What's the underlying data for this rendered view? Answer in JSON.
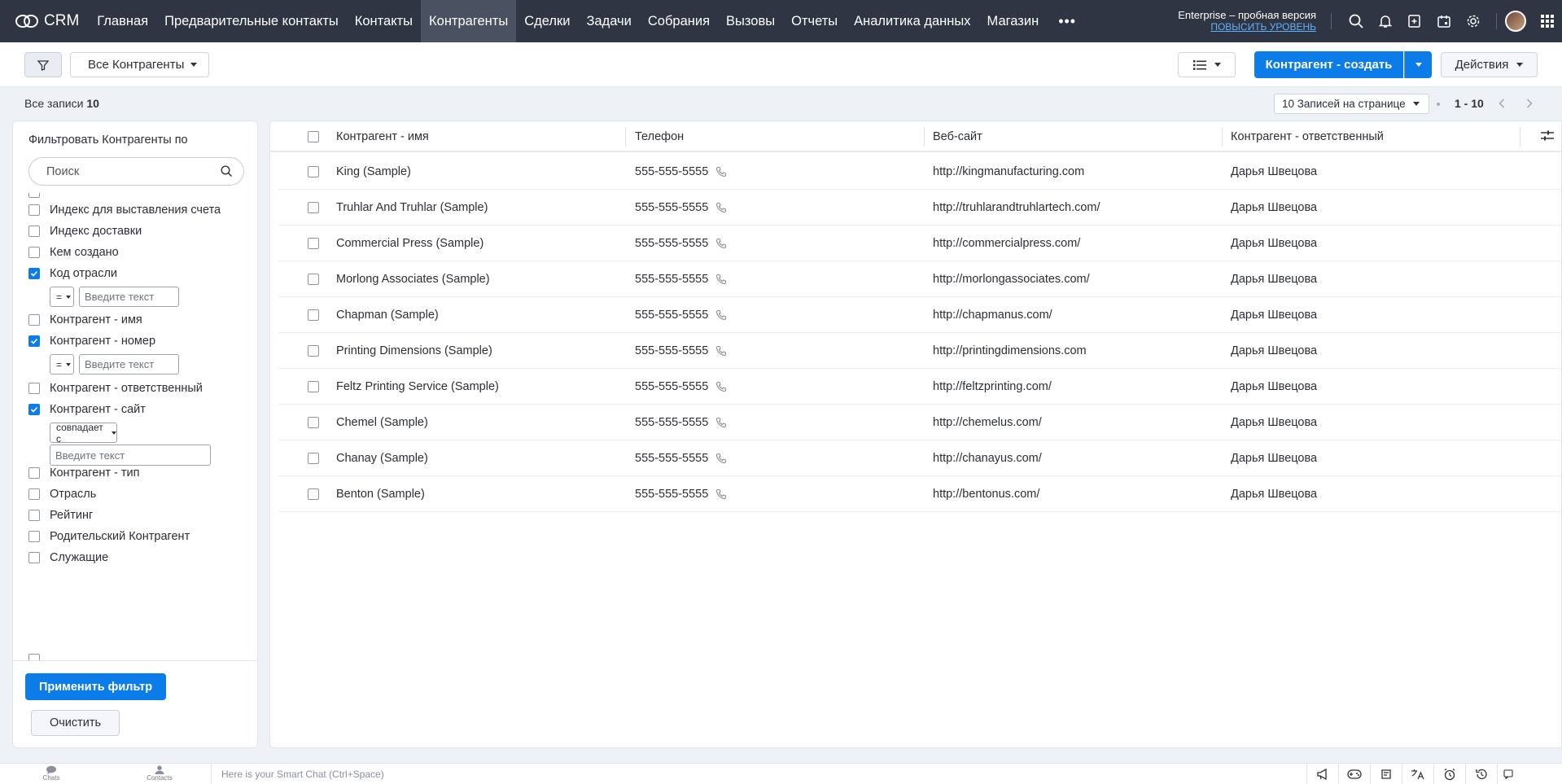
{
  "app": {
    "logo_text": "CRM"
  },
  "nav": {
    "items": [
      {
        "label": "Главная",
        "active": false
      },
      {
        "label": "Предварительные контакты",
        "active": false
      },
      {
        "label": "Контакты",
        "active": false
      },
      {
        "label": "Контрагенты",
        "active": true
      },
      {
        "label": "Сделки",
        "active": false
      },
      {
        "label": "Задачи",
        "active": false
      },
      {
        "label": "Собрания",
        "active": false
      },
      {
        "label": "Вызовы",
        "active": false
      },
      {
        "label": "Отчеты",
        "active": false
      },
      {
        "label": "Аналитика данных",
        "active": false
      },
      {
        "label": "Магазин",
        "active": false
      }
    ],
    "more_label": "•••",
    "trial_title": "Enterprise – пробная версия",
    "upgrade_link": "ПОВЫСИТЬ УРОВЕНЬ"
  },
  "toolbar": {
    "view_label": "Все Контрагенты",
    "create_label": "Контрагент - создать",
    "actions_label": "Действия"
  },
  "records": {
    "label": "Все записи",
    "count": "10",
    "per_page": "10 Записей на странице",
    "range": "1 - 10"
  },
  "filter": {
    "title": "Фильтровать Контрагенты по",
    "search_placeholder": "Поиск",
    "items": [
      {
        "label": "Индекс для выставления счета",
        "checked": false
      },
      {
        "label": "Индекс доставки",
        "checked": false
      },
      {
        "label": "Кем создано",
        "checked": false
      },
      {
        "label": "Код отрасли",
        "checked": true,
        "operator": "=",
        "input_placeholder": "Введите текст"
      },
      {
        "label": "Контрагент - имя",
        "checked": false
      },
      {
        "label": "Контрагент - номер",
        "checked": true,
        "operator": "=",
        "input_placeholder": "Введите текст"
      },
      {
        "label": "Контрагент - ответственный",
        "checked": false
      },
      {
        "label": "Контрагент - сайт",
        "checked": true,
        "operator": "совпадает с",
        "input_placeholder": "Введите текст"
      },
      {
        "label": "Контрагент - тип",
        "checked": false
      },
      {
        "label": "Отрасль",
        "checked": false
      },
      {
        "label": "Рейтинг",
        "checked": false
      },
      {
        "label": "Родительский Контрагент",
        "checked": false
      },
      {
        "label": "Служащие",
        "checked": false
      }
    ],
    "apply_label": "Применить фильтр",
    "clear_label": "Очистить"
  },
  "table": {
    "columns": [
      "Контрагент - имя",
      "Телефон",
      "Веб-сайт",
      "Контрагент - ответственный"
    ],
    "rows": [
      {
        "name": "King (Sample)",
        "phone": "555-555-5555",
        "website": "http://kingmanufacturing.com",
        "owner": "Дарья Швецова"
      },
      {
        "name": "Truhlar And Truhlar (Sample)",
        "phone": "555-555-5555",
        "website": "http://truhlarandtruhlartech.com/",
        "owner": "Дарья Швецова"
      },
      {
        "name": "Commercial Press (Sample)",
        "phone": "555-555-5555",
        "website": "http://commercialpress.com/",
        "owner": "Дарья Швецова"
      },
      {
        "name": "Morlong Associates (Sample)",
        "phone": "555-555-5555",
        "website": "http://morlongassociates.com/",
        "owner": "Дарья Швецова"
      },
      {
        "name": "Chapman (Sample)",
        "phone": "555-555-5555",
        "website": "http://chapmanus.com/",
        "owner": "Дарья Швецова"
      },
      {
        "name": "Printing Dimensions (Sample)",
        "phone": "555-555-5555",
        "website": "http://printingdimensions.com",
        "owner": "Дарья Швецова"
      },
      {
        "name": "Feltz Printing Service (Sample)",
        "phone": "555-555-5555",
        "website": "http://feltzprinting.com/",
        "owner": "Дарья Швецова"
      },
      {
        "name": "Chemel (Sample)",
        "phone": "555-555-5555",
        "website": "http://chemelus.com/",
        "owner": "Дарья Швецова"
      },
      {
        "name": "Chanay (Sample)",
        "phone": "555-555-5555",
        "website": "http://chanayus.com/",
        "owner": "Дарья Швецова"
      },
      {
        "name": "Benton (Sample)",
        "phone": "555-555-5555",
        "website": "http://bentonus.com/",
        "owner": "Дарья Швецова"
      }
    ]
  },
  "bottom": {
    "chats_label": "Chats",
    "contacts_label": "Contacts",
    "smart_chat_placeholder": "Here is your Smart Chat (Ctrl+Space)"
  },
  "colors": {
    "accent": "#0c7ce8",
    "nav_bg": "#2f3542",
    "nav_active": "#4a5160"
  }
}
